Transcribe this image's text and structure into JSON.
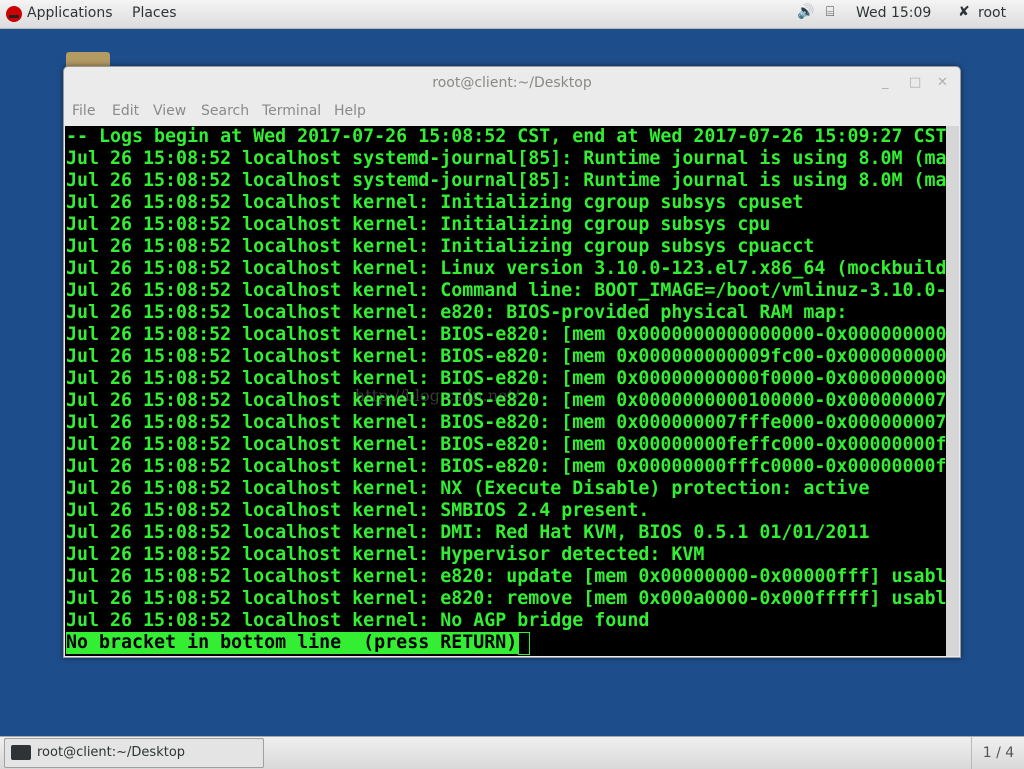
{
  "topbar": {
    "applications": "Applications",
    "places": "Places",
    "clock": "Wed 15:09",
    "user": "root",
    "volume_icon": "🔊",
    "network_icon": "⌸",
    "user_icon": "✘"
  },
  "window": {
    "title": "root@client:~/Desktop",
    "menu": [
      "File",
      "Edit",
      "View",
      "Search",
      "Terminal",
      "Help"
    ],
    "terminal_lines": [
      "-- Logs begin at Wed 2017-07-26 15:08:52 CST, end at Wed 2017-07-26 15:09:27 CST",
      "Jul 26 15:08:52 localhost systemd-journal[85]: Runtime journal is using 8.0M (ma",
      "Jul 26 15:08:52 localhost systemd-journal[85]: Runtime journal is using 8.0M (ma",
      "Jul 26 15:08:52 localhost kernel: Initializing cgroup subsys cpuset",
      "Jul 26 15:08:52 localhost kernel: Initializing cgroup subsys cpu",
      "Jul 26 15:08:52 localhost kernel: Initializing cgroup subsys cpuacct",
      "Jul 26 15:08:52 localhost kernel: Linux version 3.10.0-123.el7.x86_64 (mockbuild",
      "Jul 26 15:08:52 localhost kernel: Command line: BOOT_IMAGE=/boot/vmlinuz-3.10.0-",
      "Jul 26 15:08:52 localhost kernel: e820: BIOS-provided physical RAM map:",
      "Jul 26 15:08:52 localhost kernel: BIOS-e820: [mem 0x0000000000000000-0x000000000",
      "Jul 26 15:08:52 localhost kernel: BIOS-e820: [mem 0x000000000009fc00-0x000000000",
      "Jul 26 15:08:52 localhost kernel: BIOS-e820: [mem 0x00000000000f0000-0x000000000",
      "Jul 26 15:08:52 localhost kernel: BIOS-e820: [mem 0x0000000000100000-0x000000007",
      "Jul 26 15:08:52 localhost kernel: BIOS-e820: [mem 0x000000007fffe000-0x000000007",
      "Jul 26 15:08:52 localhost kernel: BIOS-e820: [mem 0x00000000feffc000-0x00000000f",
      "Jul 26 15:08:52 localhost kernel: BIOS-e820: [mem 0x00000000fffc0000-0x00000000f",
      "Jul 26 15:08:52 localhost kernel: NX (Execute Disable) protection: active",
      "Jul 26 15:08:52 localhost kernel: SMBIOS 2.4 present.",
      "Jul 26 15:08:52 localhost kernel: DMI: Red Hat KVM, BIOS 0.5.1 01/01/2011",
      "Jul 26 15:08:52 localhost kernel: Hypervisor detected: KVM",
      "Jul 26 15:08:52 localhost kernel: e820: update [mem 0x00000000-0x00000fff] usabl",
      "Jul 26 15:08:52 localhost kernel: e820: remove [mem 0x000a0000-0x000fffff] usabl",
      "Jul 26 15:08:52 localhost kernel: No AGP bridge found"
    ],
    "status_line": "No bracket in bottom line  (press RETURN)",
    "watermark": "http://blog.csdn.net/"
  },
  "taskbar": {
    "task_label": "root@client:~/Desktop",
    "workspace": "1 / 4"
  }
}
